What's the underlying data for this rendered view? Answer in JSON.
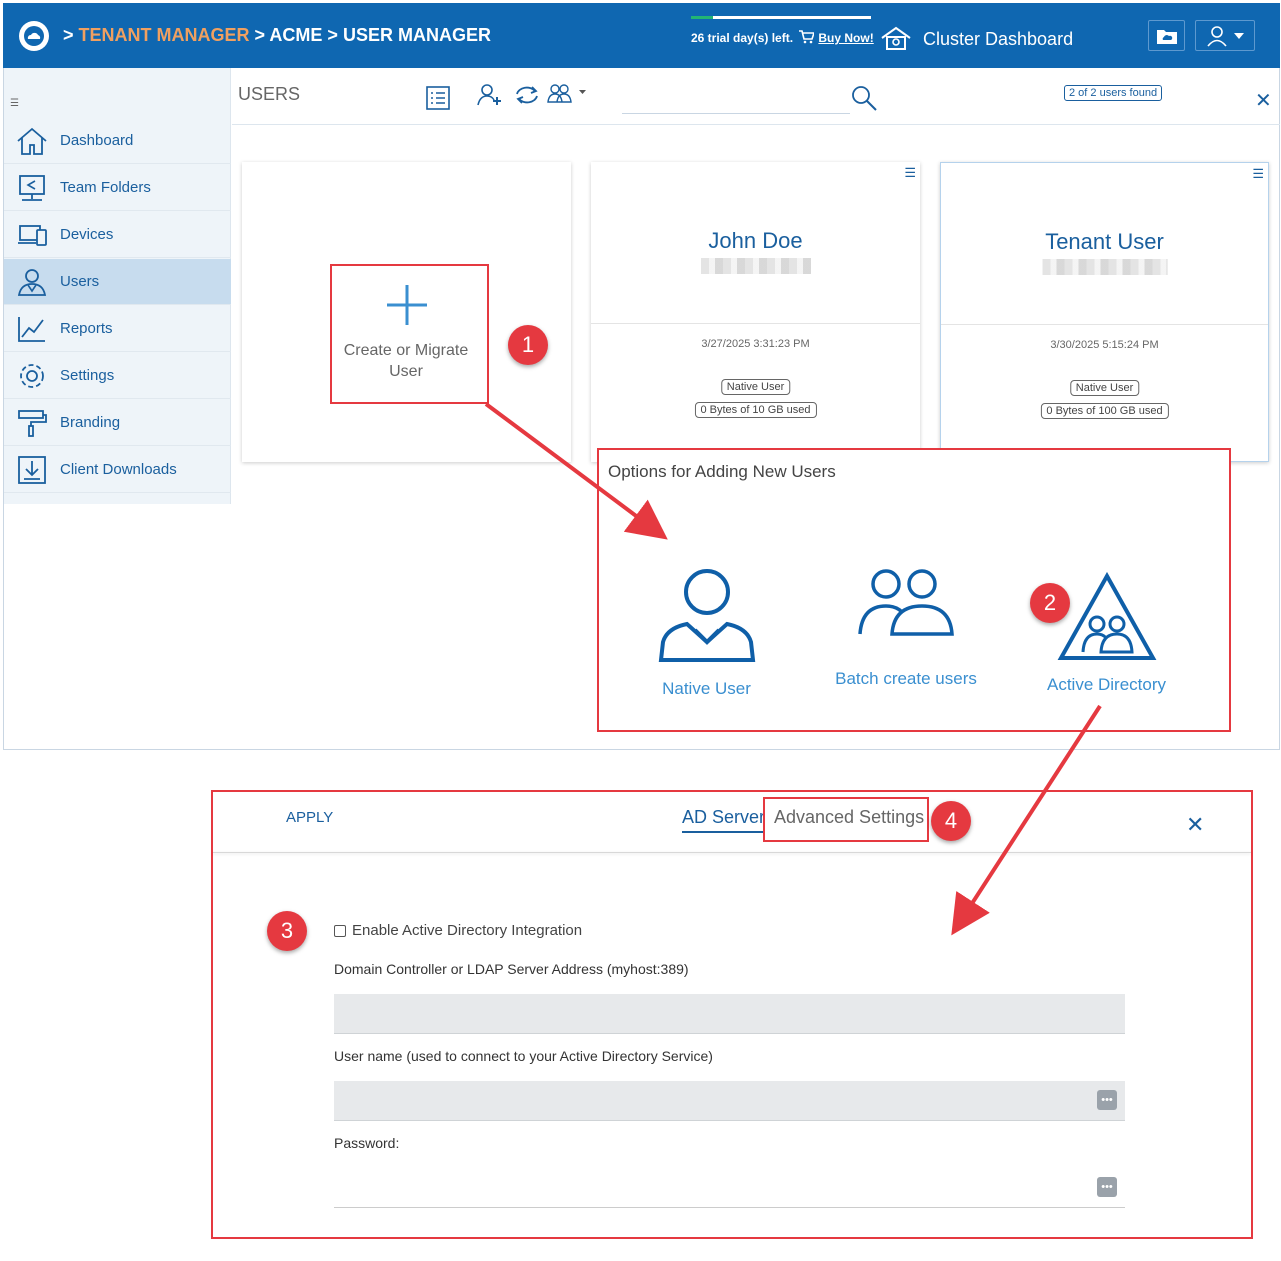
{
  "header": {
    "crumb_sep": ">",
    "crumb_tenant": "TENANT MANAGER",
    "crumb_acme": "ACME",
    "crumb_user_manager": "USER MANAGER",
    "trial_text": "26 trial day(s) left.",
    "trial_progress_fraction": 0.12,
    "buy_now": "Buy Now!",
    "cluster_dashboard": "Cluster Dashboard"
  },
  "sidebar": {
    "items": [
      {
        "label": "Dashboard",
        "icon": "home-icon"
      },
      {
        "label": "Team Folders",
        "icon": "team-folder-icon"
      },
      {
        "label": "Devices",
        "icon": "devices-icon"
      },
      {
        "label": "Users",
        "icon": "user-icon",
        "active": true
      },
      {
        "label": "Reports",
        "icon": "reports-chart-icon"
      },
      {
        "label": "Settings",
        "icon": "gear-icon"
      },
      {
        "label": "Branding",
        "icon": "paint-roller-icon"
      },
      {
        "label": "Client Downloads",
        "icon": "download-icon"
      }
    ]
  },
  "users_page": {
    "title": "USERS",
    "found_badge": "2 of 2 users found",
    "search_placeholder": ""
  },
  "cards": {
    "create_label": "Create or Migrate User",
    "john": {
      "name": "John Doe",
      "date": "3/27/2025 3:31:23 PM",
      "type": "Native User",
      "quota": "0 Bytes of 10 GB used"
    },
    "tenant": {
      "name": "Tenant User",
      "date": "3/30/2025 5:15:24 PM",
      "type": "Native User",
      "quota": "0 Bytes of 100 GB used"
    }
  },
  "options_panel": {
    "title": "Options for Adding New Users",
    "native": "Native User",
    "batch": "Batch create users",
    "ad": "Active Directory"
  },
  "ad_panel": {
    "apply": "APPLY",
    "tab_ad_server": "AD Server",
    "tab_advanced": "Advanced Settings",
    "enable_label": "Enable Active Directory Integration",
    "enable_checked": false,
    "domain_label": "Domain Controller or LDAP Server Address (myhost:389)",
    "username_label": "User name (used to connect to your Active Directory Service)",
    "password_label": "Password:"
  },
  "annotations": {
    "n1": "1",
    "n2": "2",
    "n3": "3",
    "n4": "4"
  },
  "colors": {
    "brand_blue": "#0f67b1",
    "accent_orange": "#f0a060",
    "annotation_red": "#e53940",
    "link_blue": "#1a5f9e"
  }
}
